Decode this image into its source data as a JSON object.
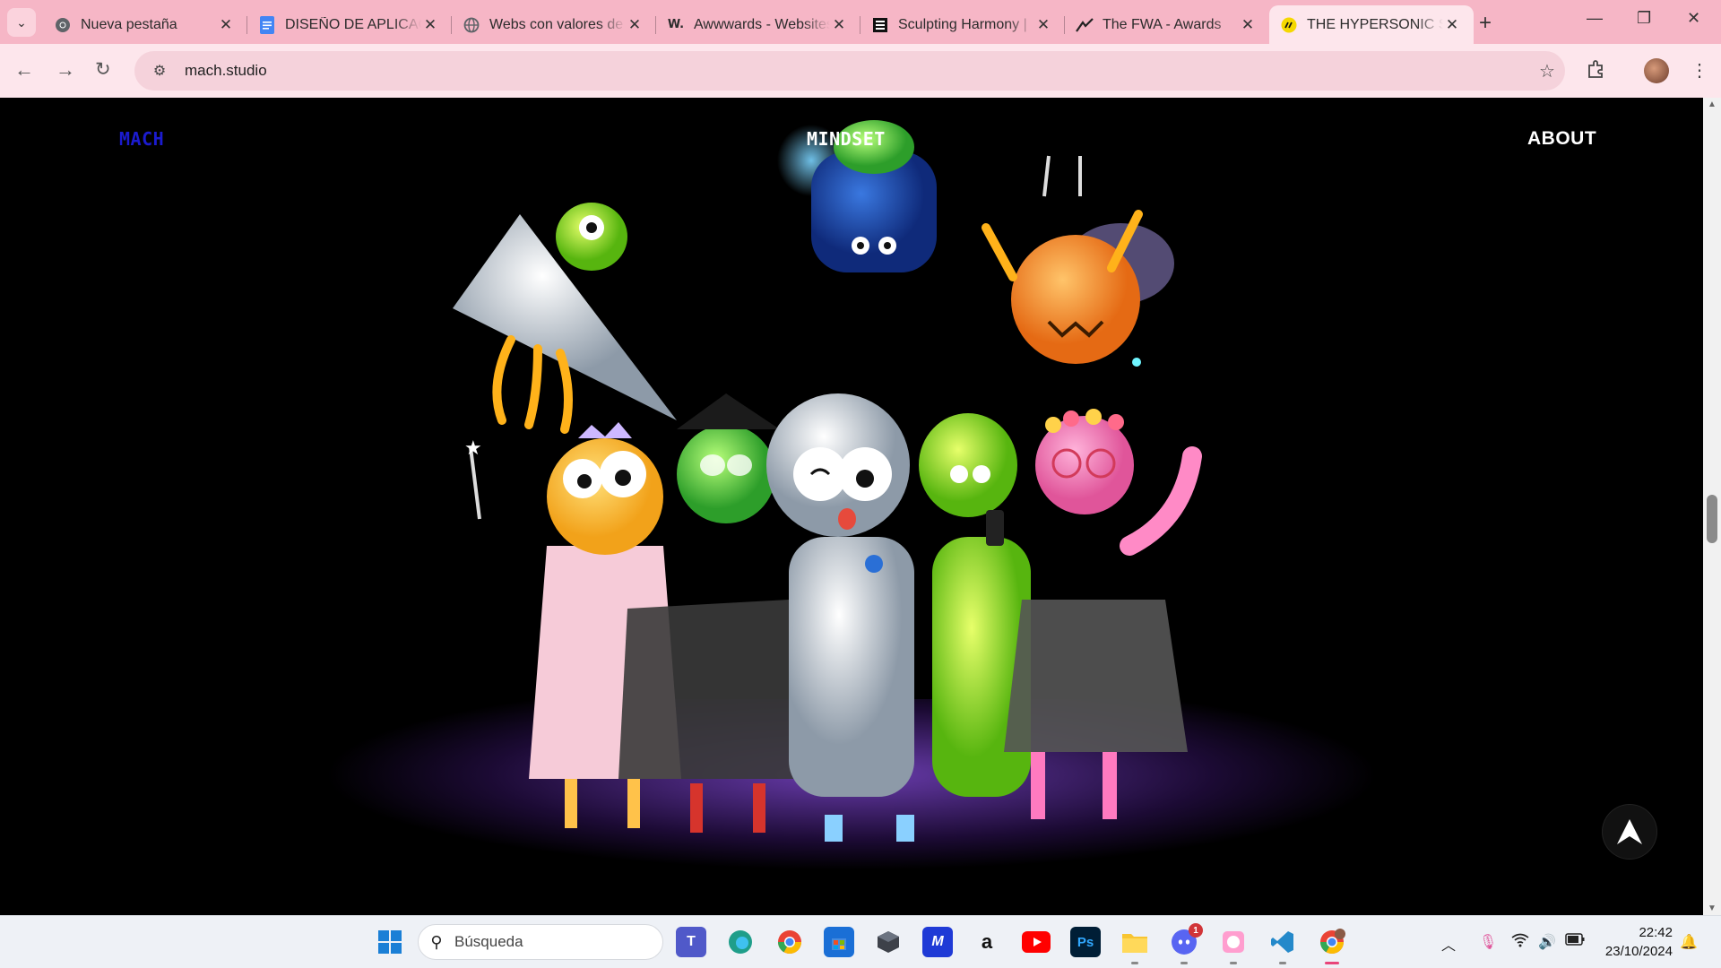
{
  "browser": {
    "tabs": [
      {
        "title": "Nueva pestaña",
        "icon": "chrome-icon"
      },
      {
        "title": "DISEÑO DE APLICACIONES",
        "icon": "docs-icon"
      },
      {
        "title": "Webs con valores de",
        "icon": "globe-icon"
      },
      {
        "title": "Awwwards - Websites",
        "icon": "awwwards-icon"
      },
      {
        "title": "Sculpting Harmony |",
        "icon": "sculpting-icon"
      },
      {
        "title": "The FWA - Awards",
        "icon": "fwa-icon"
      },
      {
        "title": "THE HYPERSONIC STUDIO",
        "icon": "mach-icon",
        "active": true
      }
    ],
    "address": "mach.studio"
  },
  "site": {
    "nav": {
      "logo": "MACH",
      "center": "MINDSET",
      "right": "ABOUT"
    },
    "colors": {
      "logo": "#1b1bcf",
      "stage_glow": "#8c50e6"
    }
  },
  "taskbar": {
    "search_placeholder": "Búsqueda",
    "apps": [
      "windows-start-icon",
      "teams-icon",
      "edge-icon",
      "chrome-icon",
      "store-icon",
      "app-cube-icon",
      "affinity-icon",
      "amazon-icon",
      "youtube-icon",
      "photoshop-icon",
      "file-explorer-icon",
      "discord-icon",
      "paint-icon",
      "vscode-icon",
      "chrome-profile-icon"
    ],
    "discord_badge": "1",
    "time": "22:42",
    "date": "23/10/2024"
  }
}
